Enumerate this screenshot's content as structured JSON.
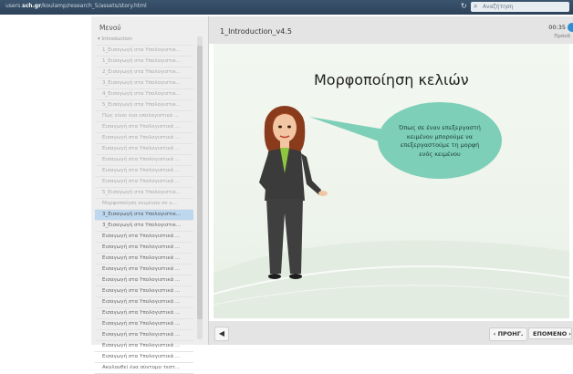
{
  "browser": {
    "url_prefix": "users.",
    "url_domain": "sch.gr",
    "url_rest": "/koulamp/research_5/assets/story.html",
    "search_placeholder": "Αναζήτηση",
    "search_icon": "magnifier-icon",
    "reload_icon": "reload-icon"
  },
  "menu": {
    "title": "Μενού",
    "items": [
      {
        "label": "▾ Introduction",
        "state": "root"
      },
      {
        "label": "1_Εισαγωγή στα Υπολογιστικ...",
        "state": "done"
      },
      {
        "label": "1_Εισαγωγή στα Υπολογιστικ...",
        "state": "done"
      },
      {
        "label": "2_Εισαγωγή στα Υπολογιστικ...",
        "state": "done"
      },
      {
        "label": "3_Εισαγωγή στα Υπολογιστικ...",
        "state": "done"
      },
      {
        "label": "4_Εισαγωγή στα Υπολογιστικ...",
        "state": "done"
      },
      {
        "label": "5_Εισαγωγή στα Υπολογιστικ...",
        "state": "done"
      },
      {
        "label": "Πώς είναι ένα υπολογιστικό ...",
        "state": "done"
      },
      {
        "label": "Εισαγωγή στα Υπολογιστικά ...",
        "state": "done"
      },
      {
        "label": "Εισαγωγή στα Υπολογιστικά ...",
        "state": "done"
      },
      {
        "label": "Εισαγωγή στα Υπολογιστικά ...",
        "state": "done"
      },
      {
        "label": "Εισαγωγή στα Υπολογιστικά ...",
        "state": "done"
      },
      {
        "label": "Εισαγωγή στα Υπολογιστικά ...",
        "state": "done"
      },
      {
        "label": "Εισαγωγή στα Υπολογιστικά ...",
        "state": "done"
      },
      {
        "label": "5_Εισαγωγή στα Υπολογιστικ...",
        "state": "done"
      },
      {
        "label": "Μορφοποίηση κειμένου σε υ...",
        "state": "done"
      },
      {
        "label": "3_Εισαγωγή στα Υπολογιστικ...",
        "state": "active"
      },
      {
        "label": "3_Εισαγωγή στα Υπολογιστικ...",
        "state": "future"
      },
      {
        "label": "Εισαγωγή στα Υπολογιστικά ...",
        "state": "future"
      },
      {
        "label": "Εισαγωγή στα Υπολογιστικά ...",
        "state": "future"
      },
      {
        "label": "Εισαγωγή στα Υπολογιστικά ...",
        "state": "future"
      },
      {
        "label": "Εισαγωγή στα Υπολογιστικά ...",
        "state": "future"
      },
      {
        "label": "Εισαγωγή στα Υπολογιστικά ...",
        "state": "future"
      },
      {
        "label": "Εισαγωγή στα Υπολογιστικά ...",
        "state": "future"
      },
      {
        "label": "Εισαγωγή στα Υπολογιστικά ...",
        "state": "future"
      },
      {
        "label": "Εισαγωγή στα Υπολογιστικά ...",
        "state": "future"
      },
      {
        "label": "Εισαγωγή στα Υπολογιστικά ...",
        "state": "future"
      },
      {
        "label": "Εισαγωγή στα Υπολογιστικά ...",
        "state": "future"
      },
      {
        "label": "Εισαγωγή στα Υπολογιστικά ...",
        "state": "future"
      },
      {
        "label": "Εισαγωγή στα Υπολογιστικά ...",
        "state": "future"
      },
      {
        "label": "Ακολουθεί ένα σύντομο τεστ...",
        "state": "future"
      }
    ]
  },
  "slide": {
    "title": "1_Introduction_v4.5",
    "time": "00:35",
    "progress_label": "Πρόοδ",
    "heading": "Μορφοποίηση κελιών",
    "bubble_lines": [
      "Όπως σε έναν επεξεργαστή",
      "κειμένου μπορούμε να",
      "επεξεργαστούμε τη μορφή",
      "ενός κειμένου"
    ]
  },
  "controls": {
    "volume_icon": "speaker-icon",
    "prev_label": "‹ ΠΡΟΗΓ.",
    "next_label": "ΕΠΟΜΕΝΟ",
    "next_chevron": "›"
  },
  "colors": {
    "active_item": "#bcd7ee",
    "bubble": "#7ecfb8",
    "progress_dot": "#2a8fd8"
  }
}
